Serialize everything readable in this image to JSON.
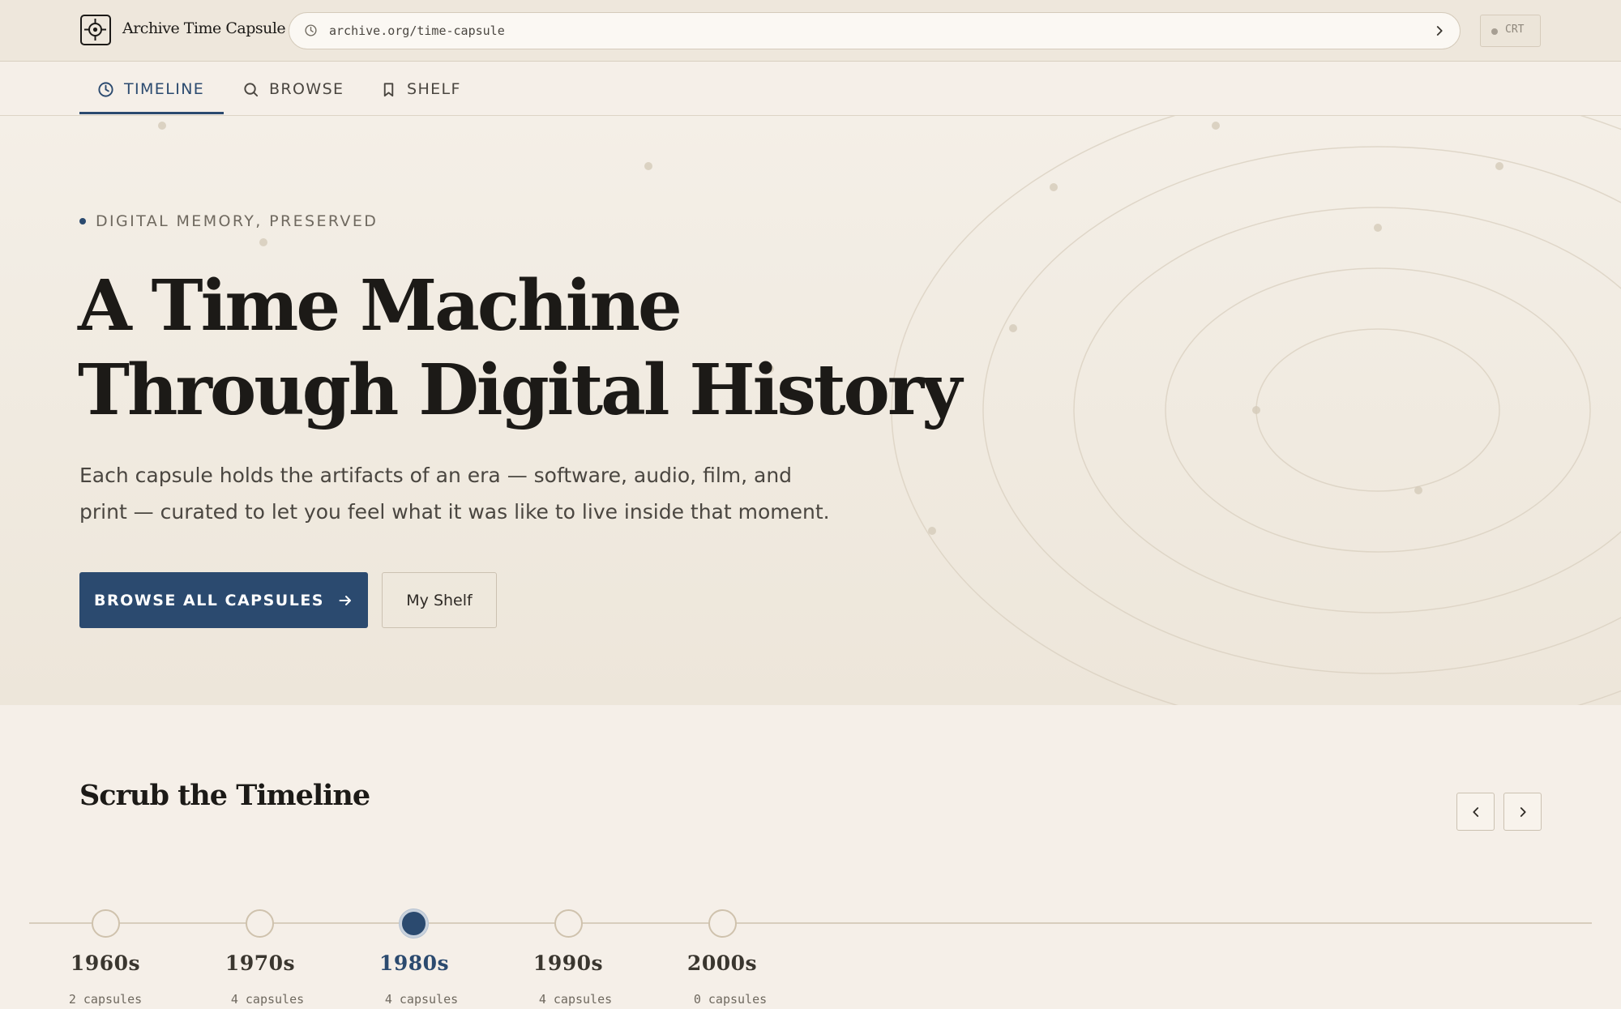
{
  "app": {
    "brand": "Archive Time Capsule",
    "url": "archive.org/time-capsule",
    "crt_label": "CRT"
  },
  "nav": {
    "tabs": [
      {
        "label": "TIMELINE",
        "icon": "clock-icon",
        "active": true
      },
      {
        "label": "BROWSE",
        "icon": "search-icon",
        "active": false
      },
      {
        "label": "SHELF",
        "icon": "bookmark-icon",
        "active": false
      }
    ]
  },
  "hero": {
    "eyebrow": "DIGITAL MEMORY, PRESERVED",
    "title_line1": "A Time Machine",
    "title_line2": "Through Digital History",
    "description": "Each capsule holds the artifacts of an era — software, audio, film, and print — curated to let you feel what it was like to live inside that moment.",
    "primary_button": "BROWSE ALL CAPSULES",
    "secondary_button": "My Shelf"
  },
  "timeline": {
    "title": "Scrub the Timeline",
    "decades": [
      {
        "label": "1960s",
        "count": "2 capsules",
        "active": false
      },
      {
        "label": "1970s",
        "count": "4 capsules",
        "active": false
      },
      {
        "label": "1980s",
        "count": "4 capsules",
        "active": true
      },
      {
        "label": "1990s",
        "count": "4 capsules",
        "active": false
      },
      {
        "label": "2000s",
        "count": "0 capsules",
        "active": false
      }
    ]
  },
  "colors": {
    "accent": "#2b4a6f",
    "background": "#f5efe8",
    "ink": "#1c1a17"
  }
}
